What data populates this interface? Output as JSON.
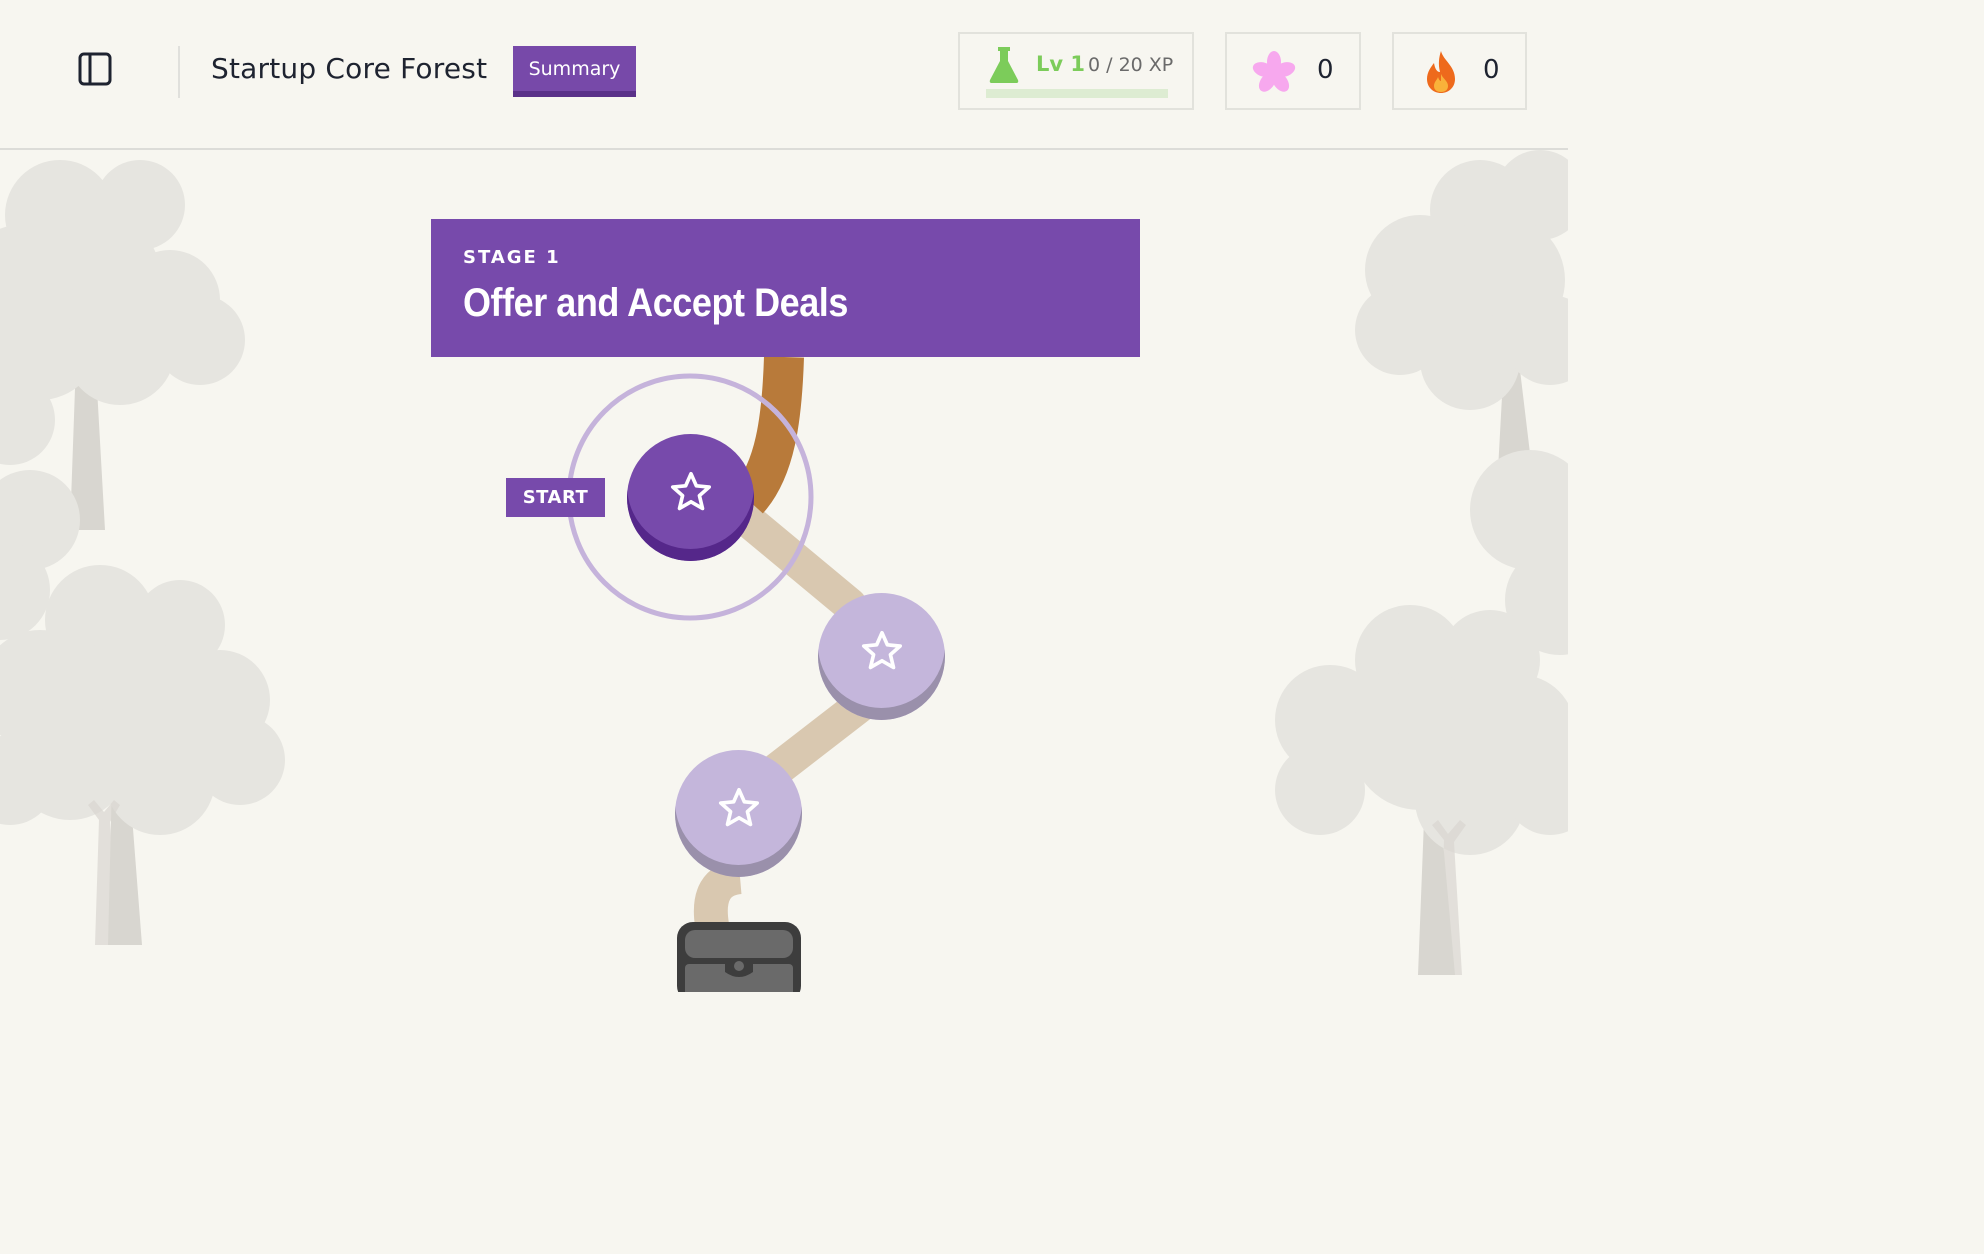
{
  "header": {
    "title": "Startup Core Forest",
    "summary_label": "Summary",
    "level_label": "Lv 1",
    "xp_label": "0 / 20 XP",
    "xp_progress": 0.0,
    "gems_value": "0",
    "streak_value": "0"
  },
  "stage": {
    "label": "STAGE 1",
    "title": "Offer and Accept Deals"
  },
  "path": {
    "start_label": "START",
    "nodes": [
      {
        "icon": "star-icon",
        "state": "current"
      },
      {
        "icon": "star-icon",
        "state": "locked"
      },
      {
        "icon": "star-icon",
        "state": "locked"
      }
    ],
    "reward": {
      "icon": "treasure-chest-icon"
    }
  },
  "colors": {
    "accent": "#774aab",
    "xp": "#7ccc5a",
    "gem": "#f7a8ee",
    "flame": "#ee6a1c",
    "path": "#d9c8b0",
    "path_active": "#b87a3a"
  }
}
